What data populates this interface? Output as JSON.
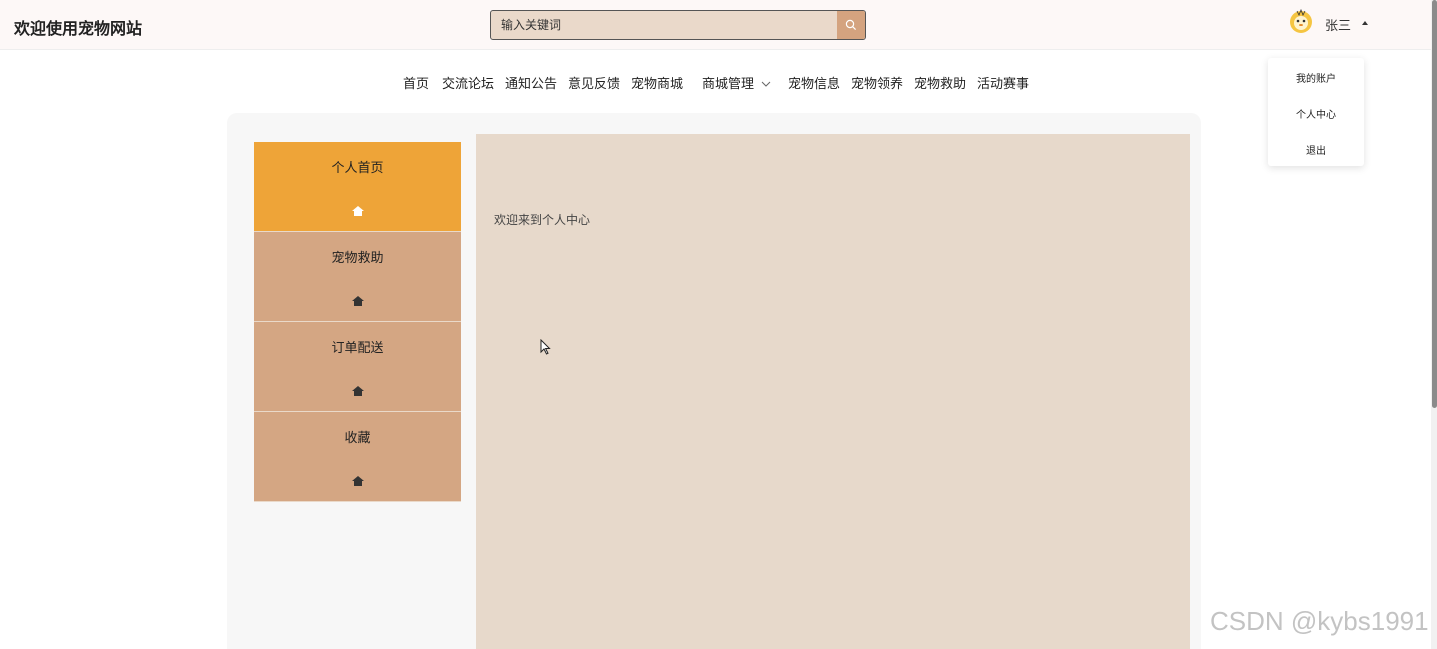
{
  "header": {
    "site_title": "欢迎使用宠物网站",
    "search_placeholder": "输入关键词",
    "username": "张三"
  },
  "dropdown": {
    "items": [
      "我的账户",
      "个人中心",
      "退出"
    ]
  },
  "nav": {
    "items": [
      "首页",
      "交流论坛",
      "通知公告",
      "意见反馈",
      "宠物商城",
      "商城管理",
      "宠物信息",
      "宠物领养",
      "宠物救助",
      "活动赛事"
    ]
  },
  "side_menu": {
    "items": [
      {
        "label": "个人首页",
        "active": true
      },
      {
        "label": "宠物救助",
        "active": false
      },
      {
        "label": "订单配送",
        "active": false
      },
      {
        "label": "收藏",
        "active": false
      }
    ]
  },
  "content": {
    "welcome_text": "欢迎来到个人中心"
  },
  "watermark": "CSDN @kybs1991",
  "colors": {
    "accent_active": "#eea438",
    "menu_bg": "#d4a683",
    "content_bg": "#e7d9cb",
    "search_btn": "#d4a37f"
  }
}
